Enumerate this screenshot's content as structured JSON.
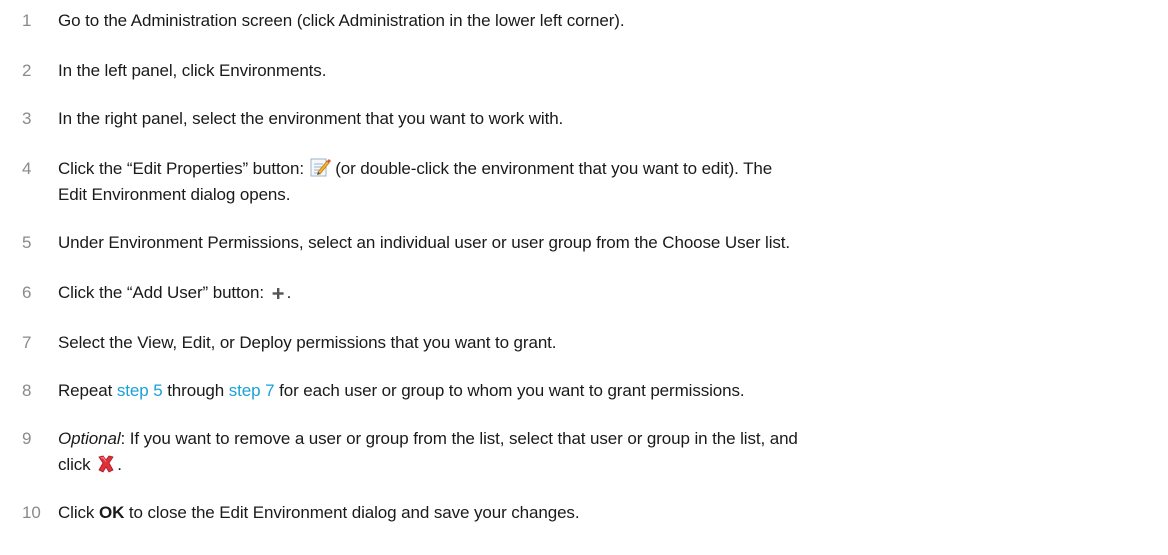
{
  "steps": [
    {
      "number": "1",
      "text": "Go to the Administration screen (click Administration in the lower left corner)."
    },
    {
      "number": "2",
      "text": "In the left panel, click Environments."
    },
    {
      "number": "3",
      "text": "In the right panel, select the environment that you want to work with."
    },
    {
      "number": "4",
      "text_before_icon": "Click the “Edit Properties” button:",
      "icon": "edit-properties-icon",
      "text_after_icon": "(or double-click the environment that you want to edit). The",
      "text_line2": "Edit Environment dialog opens."
    },
    {
      "number": "5",
      "text": "Under Environment Permissions, select an individual user or user group from the Choose User list."
    },
    {
      "number": "6",
      "text_before_icon": "Click the “Add User” button:",
      "icon": "add-user-icon",
      "text_after_icon": "."
    },
    {
      "number": "7",
      "text": "Select the View, Edit, or Deploy permissions that you want to grant."
    },
    {
      "number": "8",
      "text_before_link1": "Repeat",
      "link1": "step 5",
      "text_between": "through",
      "link2": "step 7",
      "text_after": "for each user or group to whom you want to grant permissions."
    },
    {
      "number": "9",
      "optional_label": "Optional",
      "text_line1": ": If you want to remove a user or group from the list, select that user or group in the list, and",
      "text_line2_before_icon": "click",
      "icon": "remove-icon",
      "text_line2_after_icon": "."
    },
    {
      "number": "10",
      "text_before_bold": "Click",
      "bold": "OK",
      "text_after_bold": "to close the Edit Environment dialog and save your changes."
    }
  ],
  "colors": {
    "step_number": "#8a8a8a",
    "text": "#1a1a1a",
    "link": "#1aa0d8",
    "remove_icon": "#e0303a"
  }
}
